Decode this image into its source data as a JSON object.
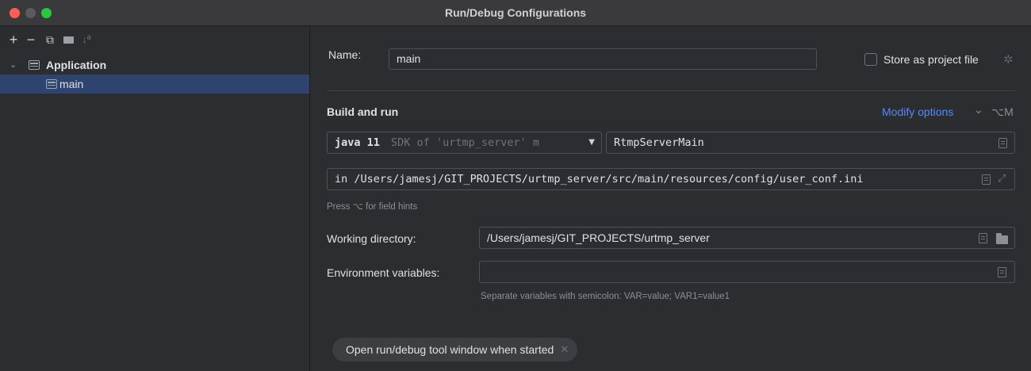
{
  "window": {
    "title": "Run/Debug Configurations"
  },
  "toolbar": {
    "add": "+",
    "remove": "−",
    "copy": "⧉",
    "sort": "↓ª"
  },
  "tree": {
    "group_label": "Application",
    "item_label": "main"
  },
  "form": {
    "name_label": "Name:",
    "name_value": "main",
    "store_label": "Store as project file",
    "build_run_label": "Build and run",
    "modify_options": "Modify options",
    "modify_chevron": "⌄",
    "modify_shortcut": "⌥M",
    "jdk_value": "java 11",
    "jdk_detail": "SDK of 'urtmp_server' m",
    "main_class": "RtmpServerMain",
    "program_args": "in /Users/jamesj/GIT_PROJECTS/urtmp_server/src/main/resources/config/user_conf.ini",
    "field_hint": "Press ⌥ for field hints",
    "workdir_label": "Working directory:",
    "workdir_value": "/Users/jamesj/GIT_PROJECTS/urtmp_server",
    "env_label": "Environment variables:",
    "env_value": "",
    "env_hint": "Separate variables with semicolon: VAR=value; VAR1=value1",
    "tool_window_option": "Open run/debug tool window when started"
  }
}
